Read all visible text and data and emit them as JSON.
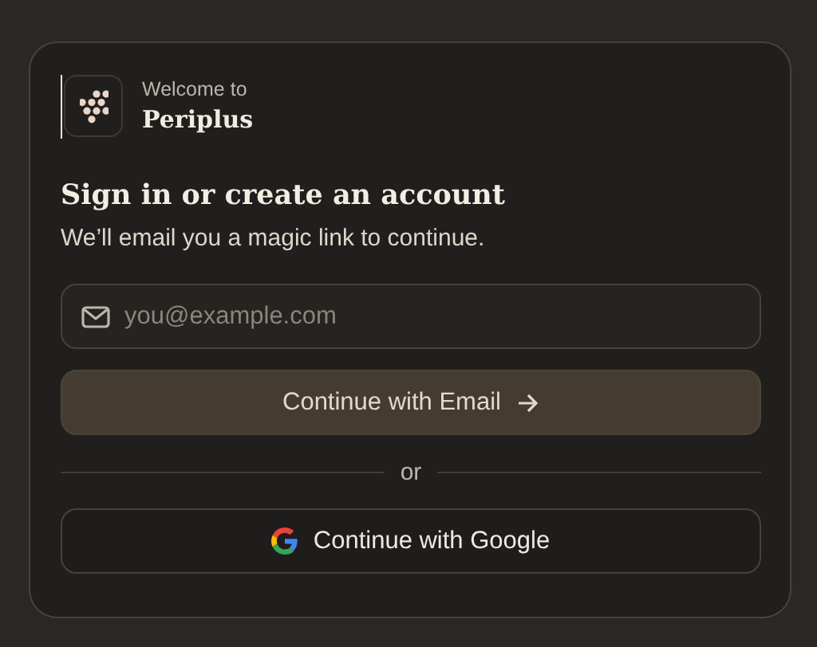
{
  "brand": {
    "eyebrow": "Welcome to",
    "name": "Periplus"
  },
  "heading": "Sign in or create an account",
  "subtitle": "We’ll email you a magic link to continue.",
  "email_field": {
    "placeholder": "you@example.com"
  },
  "email_button": {
    "label": "Continue with Email"
  },
  "divider": "or",
  "google_button": {
    "label": "Continue with Google"
  }
}
